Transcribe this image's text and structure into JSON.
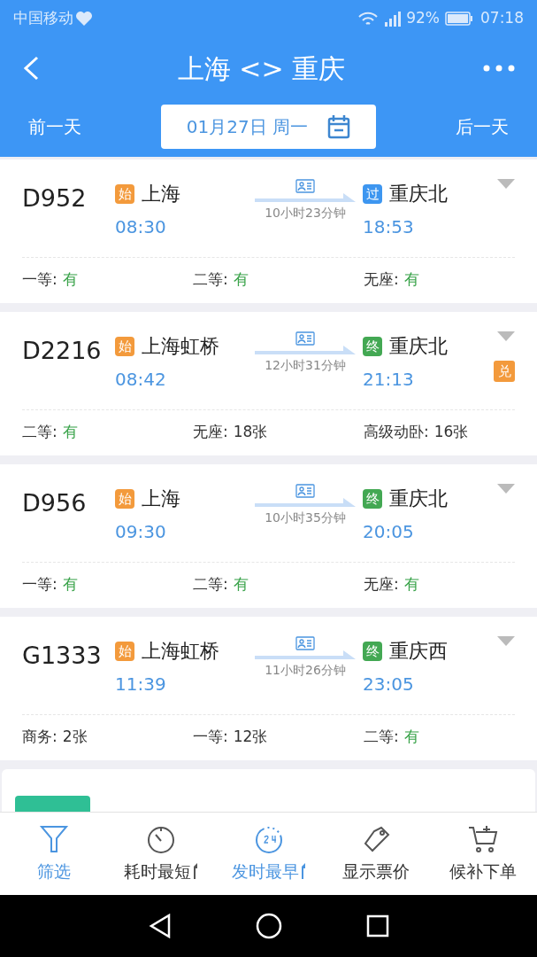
{
  "status_bar": {
    "carrier": "中国移动",
    "battery": "92%",
    "time": "07:18"
  },
  "header": {
    "title": "上海 <> 重庆",
    "prev_day": "前一天",
    "date": "01月27日 周一",
    "next_day": "后一天"
  },
  "trains": [
    {
      "number": "D952",
      "from": {
        "badge": "始",
        "kind": "start",
        "station": "上海",
        "time": "08:30"
      },
      "duration": "10小时23分钟",
      "to": {
        "badge": "过",
        "kind": "pass",
        "station": "重庆北",
        "time": "18:53"
      },
      "seats": [
        {
          "label": "一等:",
          "value": "有",
          "available": true
        },
        {
          "label": "二等:",
          "value": "有",
          "available": true
        },
        {
          "label": "无座:",
          "value": "有",
          "available": true
        }
      ]
    },
    {
      "number": "D2216",
      "from": {
        "badge": "始",
        "kind": "start",
        "station": "上海虹桥",
        "time": "08:42"
      },
      "duration": "12小时31分钟",
      "to": {
        "badge": "终",
        "kind": "end",
        "station": "重庆北",
        "time": "21:13"
      },
      "exchange": "兑",
      "seats": [
        {
          "label": "二等:",
          "value": "有",
          "available": true
        },
        {
          "label": "无座:",
          "value": "18张",
          "available": false
        },
        {
          "label": "高级动卧:",
          "value": "16张",
          "available": false
        }
      ]
    },
    {
      "number": "D956",
      "from": {
        "badge": "始",
        "kind": "start",
        "station": "上海",
        "time": "09:30"
      },
      "duration": "10小时35分钟",
      "to": {
        "badge": "终",
        "kind": "end",
        "station": "重庆北",
        "time": "20:05"
      },
      "seats": [
        {
          "label": "一等:",
          "value": "有",
          "available": true
        },
        {
          "label": "二等:",
          "value": "有",
          "available": true
        },
        {
          "label": "无座:",
          "value": "有",
          "available": true
        }
      ]
    },
    {
      "number": "G1333",
      "from": {
        "badge": "始",
        "kind": "start",
        "station": "上海虹桥",
        "time": "11:39"
      },
      "duration": "11小时26分钟",
      "to": {
        "badge": "终",
        "kind": "end",
        "station": "重庆西",
        "time": "23:05"
      },
      "seats": [
        {
          "label": "商务:",
          "value": "2张",
          "available": false
        },
        {
          "label": "一等:",
          "value": "12张",
          "available": false
        },
        {
          "label": "二等:",
          "value": "有",
          "available": true
        }
      ]
    }
  ],
  "bottom_nav": [
    {
      "label": "筛选",
      "kind": "filter",
      "selected": true,
      "sortable": false
    },
    {
      "label": "耗时最短",
      "kind": "timer",
      "selected": false,
      "sortable": true
    },
    {
      "label": "发时最早",
      "kind": "clock24",
      "selected": true,
      "sortable": true
    },
    {
      "label": "显示票价",
      "kind": "tag",
      "selected": false,
      "sortable": false
    },
    {
      "label": "候补下单",
      "kind": "cart",
      "selected": false,
      "sortable": false
    }
  ]
}
